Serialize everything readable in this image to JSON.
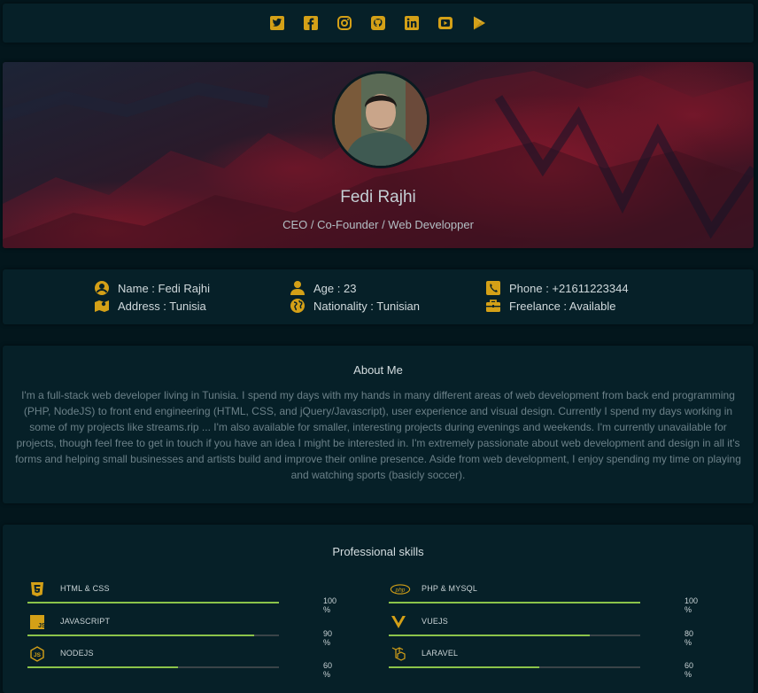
{
  "social": {
    "icons": [
      "twitter-icon",
      "facebook-icon",
      "instagram-icon",
      "github-icon",
      "linkedin-icon",
      "youtube-icon",
      "google-play-icon"
    ]
  },
  "profile": {
    "name": "Fedi Rajhi",
    "role": "CEO / Co-Founder / Web Developper"
  },
  "info": {
    "name": "Name : Fedi Rajhi",
    "address": "Address : Tunisia",
    "age": "Age : 23",
    "nationality": "Nationality : Tunisian",
    "phone": "Phone : +21611223344",
    "freelance": "Freelance : Available"
  },
  "about": {
    "title": "About Me",
    "text": "I'm a full-stack web developer living in Tunisia. I spend my days with my hands in many different areas of web development from back end programming (PHP, NodeJS) to front end engineering (HTML, CSS, and jQuery/Javascript), user experience and visual design. Currently I spend my days working in some of my projects like streams.rip ... I'm also available for smaller, interesting projects during evenings and weekends. I'm currently unavailable for projects, though feel free to get in touch if you have an idea I might be interested in. I'm extremely passionate about web development and design in all it's forms and helping small businesses and artists build and improve their online presence. Aside from web development, I enjoy spending my time on playing and watching sports (basicly soccer)."
  },
  "skills": {
    "title": "Professional skills",
    "items": [
      {
        "name": "HTML & CSS",
        "percent_label": "100 %",
        "level": 1.0,
        "icon": "html5-icon"
      },
      {
        "name": "PHP & MYSQL",
        "percent_label": "100 %",
        "level": 1.0,
        "icon": "php-icon"
      },
      {
        "name": "JAVASCRIPT",
        "percent_label": "90 %",
        "level": 0.9,
        "icon": "javascript-icon"
      },
      {
        "name": "VUEJS",
        "percent_label": "80 %",
        "level": 0.8,
        "icon": "vuejs-icon"
      },
      {
        "name": "NODEJS",
        "percent_label": "60 %",
        "level": 0.6,
        "icon": "nodejs-icon"
      },
      {
        "name": "LARAVEL",
        "percent_label": "60 %",
        "level": 0.6,
        "icon": "laravel-icon"
      }
    ]
  },
  "colors": {
    "accent": "#d4a017",
    "bar_fill": "#8bc34a",
    "card": "#062028",
    "background": "#03161c"
  }
}
